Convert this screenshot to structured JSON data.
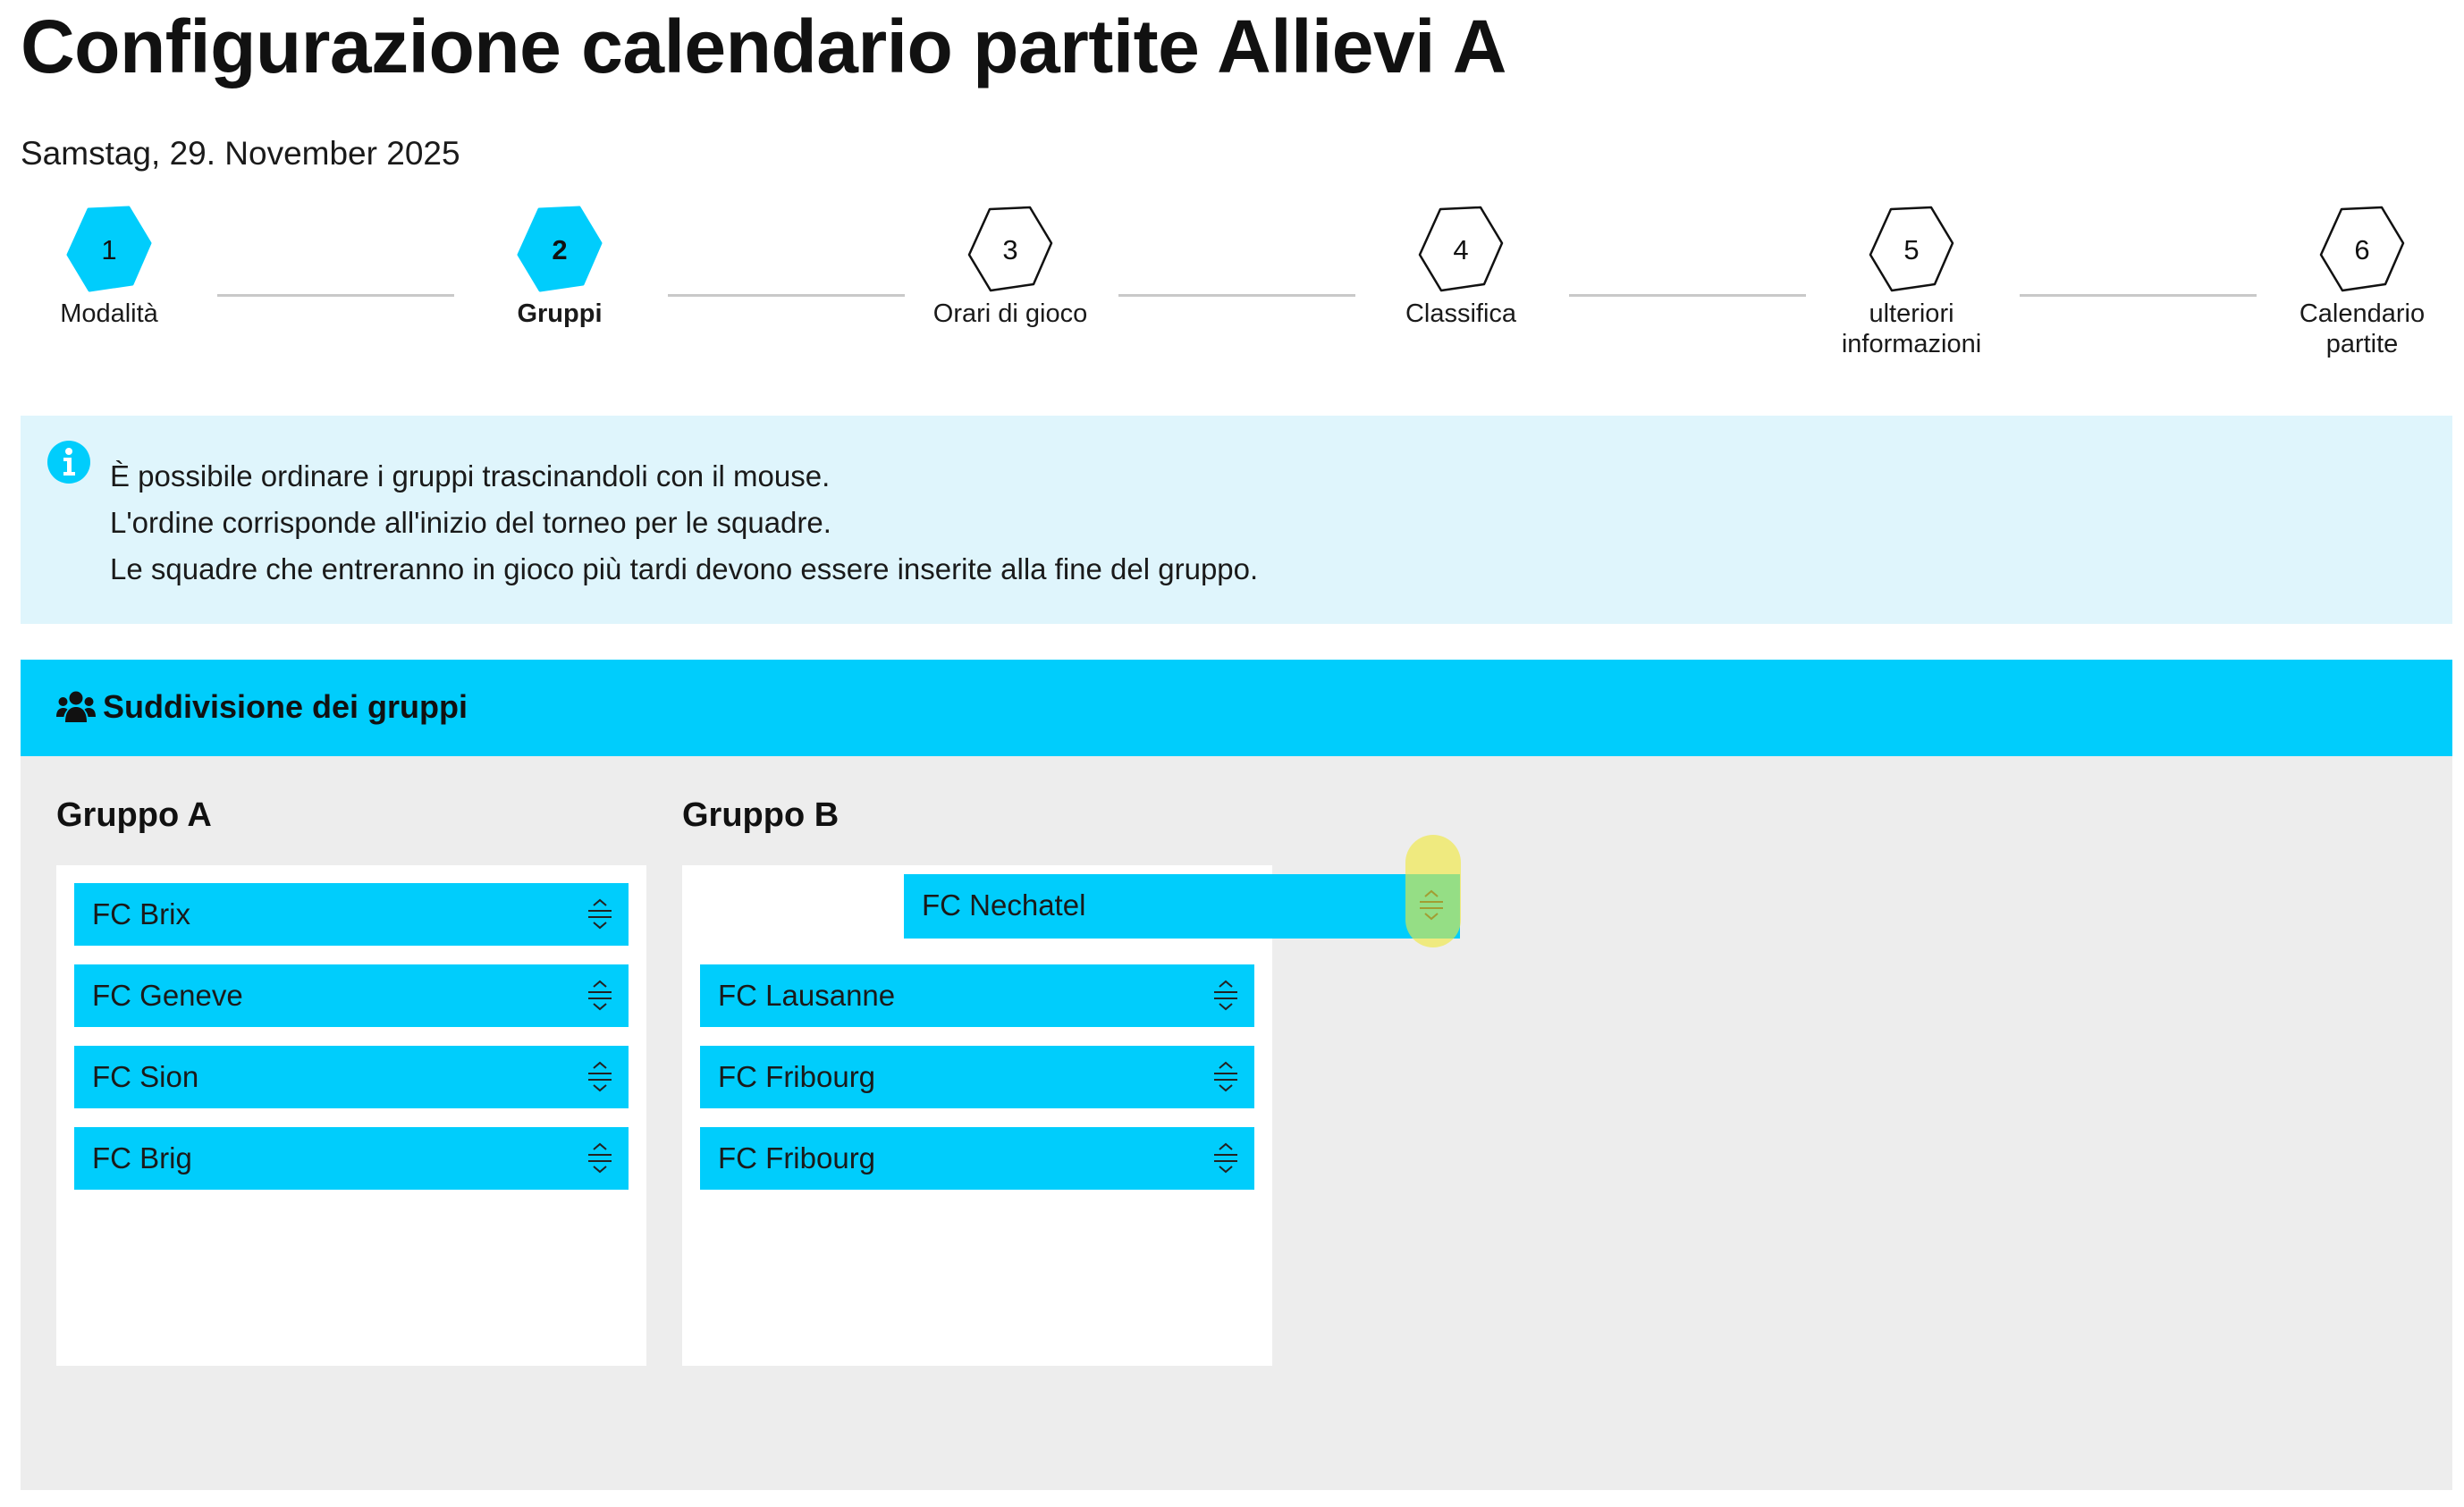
{
  "page": {
    "title": "Configurazione calendario partite Allievi A",
    "date": "Samstag, 29. November 2025"
  },
  "stepper": {
    "steps": [
      {
        "number": "1",
        "label": "Modalità",
        "state": "done"
      },
      {
        "number": "2",
        "label": "Gruppi",
        "state": "active"
      },
      {
        "number": "3",
        "label": "Orari di gioco",
        "state": "todo"
      },
      {
        "number": "4",
        "label": "Classifica",
        "state": "todo"
      },
      {
        "number": "5",
        "label": "ulteriori informazioni",
        "label_line1": "ulteriori",
        "label_line2": "informazioni",
        "state": "todo"
      },
      {
        "number": "6",
        "label": "Calendario partite",
        "label_line1": "Calendario",
        "label_line2": "partite",
        "state": "todo"
      }
    ]
  },
  "info": {
    "icon": "info-icon",
    "lines": [
      "È possibile ordinare i gruppi trascinandoli con il mouse.",
      "L'ordine corrisponde all'inizio del torneo per le squadre.",
      "Le squadre che entreranno in gioco più tardi devono essere inserite alla fine del gruppo."
    ]
  },
  "groups": {
    "header_icon": "users-icon",
    "header_title": "Suddivisione dei gruppi",
    "list": [
      {
        "title": "Gruppo A",
        "teams": [
          "FC Brix",
          "FC Geneve",
          "FC Sion",
          "FC Brig"
        ]
      },
      {
        "title": "Gruppo B",
        "teams": [
          "FC Lausanne",
          "FC Fribourg",
          "FC Fribourg"
        ]
      }
    ],
    "dragging_team": "FC Nechatel",
    "handle_icon": "drag-handle-icon"
  },
  "colors": {
    "accent": "#00cdfc",
    "info_background": "#dff5fc",
    "panel_background": "#ededed",
    "connector": "#c9c9c9",
    "cursor_highlight": "#f0e83c"
  }
}
